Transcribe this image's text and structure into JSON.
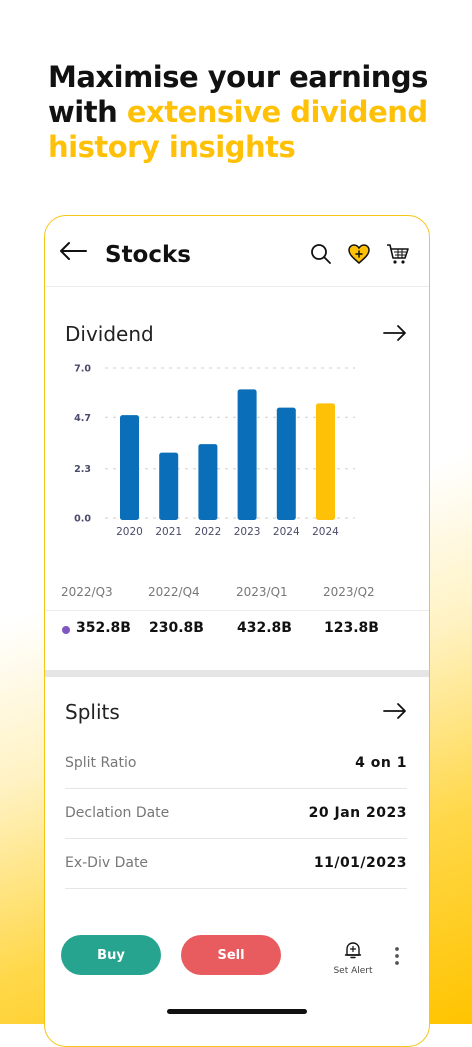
{
  "headline": {
    "line1": "Maximise your earnings",
    "line2_prefix": "with ",
    "line2_highlight": "extensive dividend",
    "line3_highlight": "history insights"
  },
  "header": {
    "title": "Stocks"
  },
  "dividend": {
    "title": "Dividend",
    "chart_data": {
      "type": "bar",
      "categories": [
        "2020",
        "2021",
        "2022",
        "2023",
        "2024",
        "2024"
      ],
      "values": [
        4.8,
        3.05,
        3.45,
        6.0,
        5.15,
        5.35
      ],
      "ylim": [
        0,
        7.0
      ],
      "yticks": [
        "0.0",
        "2.3",
        "4.7",
        "7.0"
      ],
      "grid": true,
      "colors": [
        "#0a6fb8",
        "#0a6fb8",
        "#0a6fb8",
        "#0a6fb8",
        "#0a6fb8",
        "#ffc107"
      ]
    },
    "quarters": [
      "2022/Q3",
      "2022/Q4",
      "2023/Q1",
      "2023/Q2"
    ],
    "values": [
      "352.8B",
      "230.8B",
      "432.8B",
      "123.8B"
    ]
  },
  "splits": {
    "title": "Splits",
    "rows": [
      {
        "label": "Split Ratio",
        "value": "4 on 1"
      },
      {
        "label": "Declation Date",
        "value": "20 Jan 2023"
      },
      {
        "label": "Ex-Div Date",
        "value": "11/01/2023"
      }
    ]
  },
  "actions": {
    "buy": "Buy",
    "sell": "Sell",
    "alert": "Set Alert"
  },
  "colors": {
    "accent": "#ffc107",
    "buy": "#26a48f",
    "sell": "#e85c5f",
    "bar": "#0a6fb8",
    "dot": "#7e57c2"
  }
}
